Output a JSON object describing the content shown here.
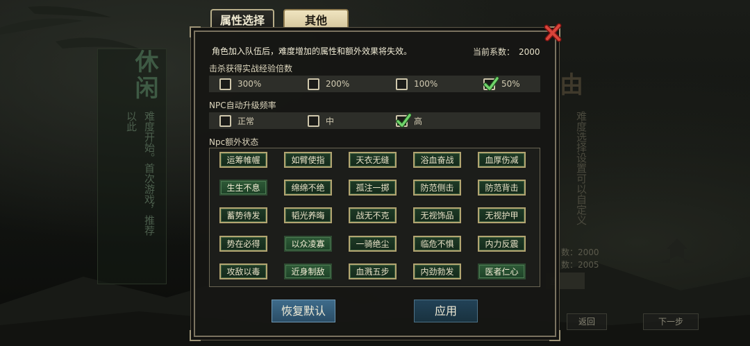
{
  "tabs": {
    "attribute": "属性选择",
    "other": "其他"
  },
  "notice": "角色加入队伍后，难度增加的属性和额外效果将失效。",
  "coefficient": {
    "label": "当前系数：",
    "value": "2000"
  },
  "exp_multiplier": {
    "label": "击杀获得实战经验倍数",
    "options": [
      {
        "label": "300%",
        "checked": false
      },
      {
        "label": "200%",
        "checked": false
      },
      {
        "label": "100%",
        "checked": false
      },
      {
        "label": "50%",
        "checked": true
      }
    ]
  },
  "npc_upgrade": {
    "label": "NPC自动升级频率",
    "options": [
      {
        "label": "正常",
        "checked": false
      },
      {
        "label": "中",
        "checked": false
      },
      {
        "label": "高",
        "checked": true
      }
    ]
  },
  "npc_status": {
    "label": "Npc额外状态",
    "chips": [
      {
        "label": "运筹帷幄",
        "active": false
      },
      {
        "label": "如臂使指",
        "active": false
      },
      {
        "label": "天衣无缝",
        "active": false
      },
      {
        "label": "浴血奋战",
        "active": false
      },
      {
        "label": "血厚伤减",
        "active": false
      },
      {
        "label": "生生不息",
        "active": true
      },
      {
        "label": "绵绵不绝",
        "active": false
      },
      {
        "label": "孤注一掷",
        "active": false
      },
      {
        "label": "防范侧击",
        "active": false
      },
      {
        "label": "防范背击",
        "active": false
      },
      {
        "label": "蓄势待发",
        "active": false
      },
      {
        "label": "韬光养晦",
        "active": false
      },
      {
        "label": "战无不克",
        "active": false
      },
      {
        "label": "无视饰品",
        "active": false
      },
      {
        "label": "无视护甲",
        "active": false
      },
      {
        "label": "势在必得",
        "active": false
      },
      {
        "label": "以众凌寡",
        "active": true
      },
      {
        "label": "一骑绝尘",
        "active": false
      },
      {
        "label": "临危不惧",
        "active": false
      },
      {
        "label": "内力反震",
        "active": false
      },
      {
        "label": "攻敌以毒",
        "active": false
      },
      {
        "label": "近身制敌",
        "active": true
      },
      {
        "label": "血溅五步",
        "active": false
      },
      {
        "label": "内劲勃发",
        "active": false
      },
      {
        "label": "医者仁心",
        "active": true
      }
    ]
  },
  "buttons": {
    "reset": "恢复默认",
    "apply": "应用"
  },
  "background": {
    "left_title": "休闲",
    "left_text": "难度开始。首次游戏，推荐以此",
    "right_title": "由",
    "right_text": "难度选择设置可以自定义",
    "stat_1": "数：2000",
    "stat_2": "数：2005",
    "setting": "置",
    "back": "返回",
    "next": "下一步"
  },
  "colors": {
    "chip_border": "#b3a571",
    "chip_active": "#2e5a37",
    "check": "#6fd36a"
  }
}
